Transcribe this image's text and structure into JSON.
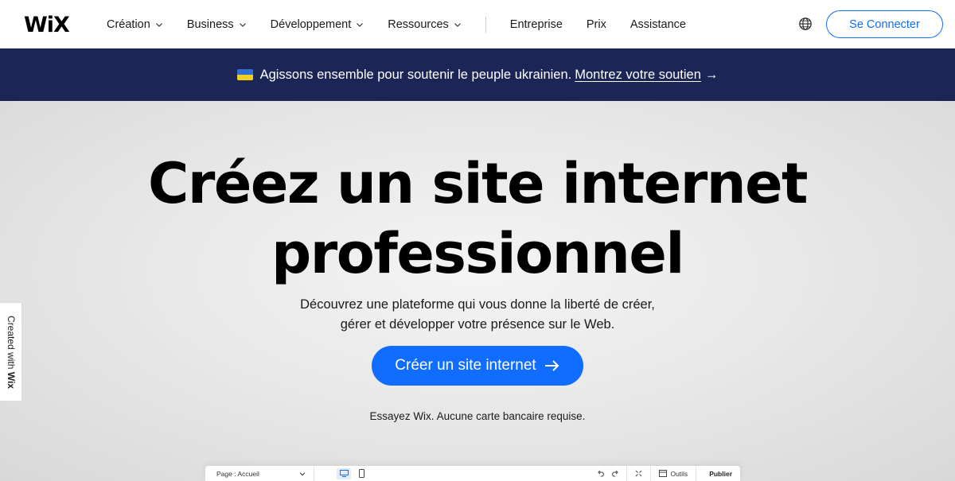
{
  "header": {
    "logo": "WiX",
    "nav": [
      {
        "label": "Création",
        "has_dropdown": true
      },
      {
        "label": "Business",
        "has_dropdown": true
      },
      {
        "label": "Développement",
        "has_dropdown": true
      },
      {
        "label": "Ressources",
        "has_dropdown": true
      }
    ],
    "nav_secondary": [
      {
        "label": "Entreprise"
      },
      {
        "label": "Prix"
      },
      {
        "label": "Assistance"
      }
    ],
    "language_icon": "globe-icon",
    "login_label": "Se Connecter"
  },
  "banner": {
    "flag_icon": "ukraine-flag-icon",
    "text": "Agissons ensemble pour soutenir le peuple ukrainien.",
    "link": "Montrez votre soutien",
    "arrow": "→"
  },
  "hero": {
    "title_line1": "Créez un site internet",
    "title_line2": "professionnel",
    "subtitle_line1": "Découvrez une plateforme qui vous donne la liberté de créer,",
    "subtitle_line2": "gérer et développer votre présence sur le Web.",
    "cta_label": "Créer un site internet",
    "note": "Essayez Wix. Aucune carte bancaire requise."
  },
  "side_tab": {
    "prefix": "Created with",
    "brand": "Wix"
  },
  "editor_bar": {
    "page_label": "Page : Accueil",
    "tools_label": "Outils",
    "publish_label": "Publier"
  },
  "colors": {
    "accent": "#116dff",
    "banner_bg": "#1c2656",
    "hero_bg": "#e6e6e6"
  }
}
